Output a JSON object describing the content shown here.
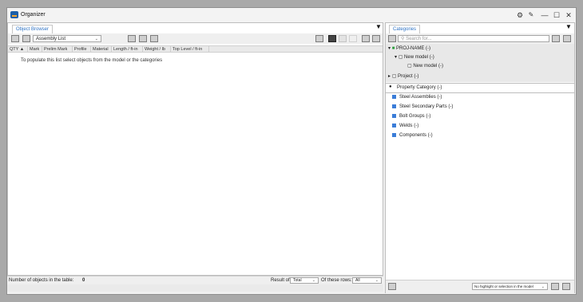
{
  "window": {
    "title": "Organizer"
  },
  "left": {
    "tab": "Object Browser",
    "menu_glyph": "▼",
    "select_value": "Assembly List",
    "columns": [
      "QTY ▲",
      "Mark",
      "Prelim Mark",
      "Profile",
      "Material",
      "Length / ft-in",
      "Weight / lb",
      "Top Level / ft-in"
    ],
    "empty_message": "To populate this list select objects from the model or the categories",
    "status_label": "Number of objects in the table:",
    "status_count": "0",
    "result_label": "Result of:",
    "result_value": "Total",
    "rows_label": "Of these rows:",
    "rows_value": "All"
  },
  "right": {
    "tab": "Categories",
    "menu_glyph": "▼",
    "search_placeholder": "Search for...",
    "tree": [
      {
        "label": "PROJ-NAME (-)"
      },
      {
        "label": "New model (-)"
      },
      {
        "label": "New model (-)"
      },
      {
        "label": "Project (-)"
      }
    ],
    "property_category": "Property Category (-)",
    "items": [
      {
        "label": "Steel Assemblies (-)"
      },
      {
        "label": "Steel Secondary Parts (-)"
      },
      {
        "label": "Bolt Groups (-)"
      },
      {
        "label": "Welds (-)"
      },
      {
        "label": "Components (-)"
      }
    ],
    "footer_select": "No highlight or selection in the model"
  }
}
